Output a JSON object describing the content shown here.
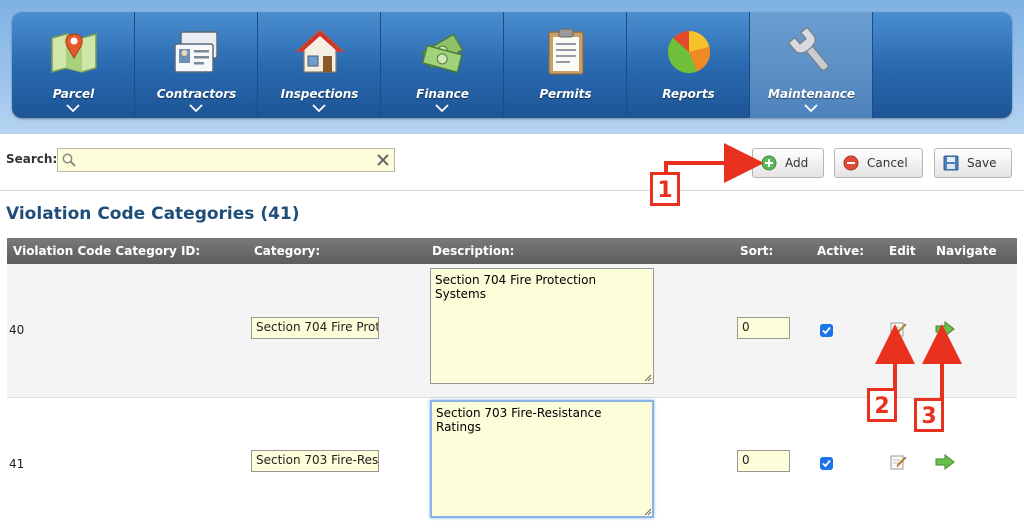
{
  "nav": {
    "items": [
      {
        "label": "Parcel",
        "icon": "map-pin-icon",
        "has_menu": true
      },
      {
        "label": "Contractors",
        "icon": "id-cards-icon",
        "has_menu": true
      },
      {
        "label": "Inspections",
        "icon": "house-icon",
        "has_menu": true
      },
      {
        "label": "Finance",
        "icon": "money-stack-icon",
        "has_menu": true
      },
      {
        "label": "Permits",
        "icon": "clipboard-icon",
        "has_menu": false
      },
      {
        "label": "Reports",
        "icon": "pie-chart-icon",
        "has_menu": false
      },
      {
        "label": "Maintenance",
        "icon": "wrench-icon",
        "has_menu": true,
        "active": true
      }
    ]
  },
  "toolbar": {
    "search_label": "Search:",
    "search_value": "",
    "search_placeholder": "",
    "add_label": "Add",
    "cancel_label": "Cancel",
    "save_label": "Save"
  },
  "page": {
    "title": "Violation Code Categories (41)"
  },
  "table": {
    "columns": [
      "Violation Code Category ID:",
      "Category:",
      "Description:",
      "Sort:",
      "Active:",
      "Edit",
      "Navigate"
    ],
    "rows": [
      {
        "id": "40",
        "category": "Section 704 Fire Prot",
        "description": "Section 704 Fire Protection Systems",
        "sort": "0",
        "active": true
      },
      {
        "id": "41",
        "category": "Section 703 Fire-Res",
        "description": "Section 703 Fire-Resistance Ratings",
        "sort": "0",
        "active": true
      }
    ]
  },
  "annotations": [
    "1",
    "2",
    "3"
  ],
  "colors": {
    "nav_bg": "#2a6ab0",
    "title_color": "#1f4d79",
    "annotation_red": "#e8321e",
    "input_bg": "#fdfdd9",
    "checkbox_blue": "#1a73e8"
  }
}
